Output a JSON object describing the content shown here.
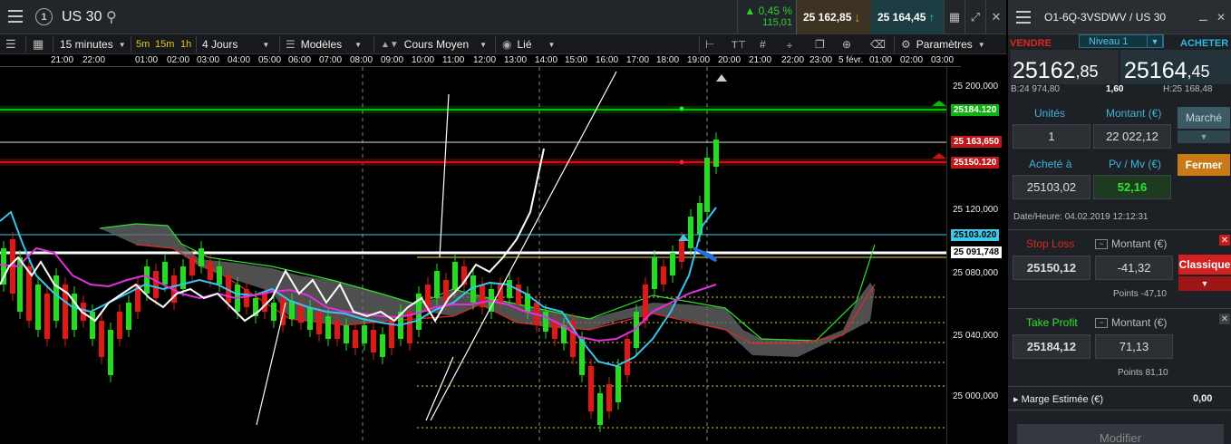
{
  "header": {
    "symbol": "US 30",
    "change_pct": "▲ 0,45 %",
    "change_abs": "115,01",
    "sell_price": "25 162,85",
    "buy_price": "25 164,45"
  },
  "toolbar": {
    "timeframe": "15 minutes",
    "quick_frames": [
      "5m",
      "15m",
      "1h"
    ],
    "period": "4 Jours",
    "models": "Modèles",
    "indicator": "Cours Moyen",
    "link": "Lié",
    "settings": "Paramètres"
  },
  "time_axis": [
    "21:00",
    "22:00",
    "01:00",
    "02:00",
    "03:00",
    "04:00",
    "05:00",
    "06:00",
    "07:00",
    "08:00",
    "09:00",
    "10:00",
    "11:00",
    "12:00",
    "13:00",
    "14:00",
    "15:00",
    "16:00",
    "17:00",
    "18:00",
    "19:00",
    "20:00",
    "21:00",
    "22:00",
    "23:00",
    "5 févr.",
    "01:00",
    "02:00",
    "03:00"
  ],
  "price_axis": {
    "labels": [
      "25 200,000",
      "25 160,000",
      "25 120,000",
      "25 080,000",
      "25 040,000",
      "25 000,000"
    ],
    "take_profit_tag": "25184.120",
    "current_tag": "25 163,650",
    "stop_loss_tag": "25150.120",
    "entry_tag": "25103.020",
    "line_tag": "25 091,748"
  },
  "order_panel": {
    "title": "O1-6Q-3VSDWV / US 30",
    "sell_label": "VENDRE",
    "buy_label": "ACHETER",
    "level": "Niveau 1",
    "sell_main": "25162",
    "sell_dec": ",85",
    "buy_main": "25164",
    "buy_dec": ",45",
    "bid": "B:24 974,80",
    "spread": "1,60",
    "high": "H:25 168,48",
    "units_label": "Unités",
    "units_value": "1",
    "amount_label": "Montant (€)",
    "amount_value": "22 022,12",
    "market_btn": "Marché",
    "bought_at_label": "Acheté à",
    "bought_at_value": "25103,02",
    "pnl_label": "Pv / Mv (€)",
    "pnl_value": "52,16",
    "close_btn": "Fermer",
    "datetime": "Date/Heure: 04.02.2019 12:12:31",
    "stop_loss": {
      "label": "Stop Loss",
      "amount_label": "Montant (€)",
      "price": "25150,12",
      "amount": "-41,32",
      "points": "Points -47,10",
      "type_btn": "Classique"
    },
    "take_profit": {
      "label": "Take Profit",
      "amount_label": "Montant (€)",
      "price": "25184,12",
      "amount": "71,13",
      "points": "Points 81,10"
    },
    "margin_label": "Marge Estimée (€)",
    "margin_value": "0,00",
    "modify_btn": "Modifier"
  },
  "colors": {
    "take_profit": "#00c000",
    "stop_loss": "#d01010",
    "entry": "#3fc8e8",
    "bullish_candle": "#22dd22",
    "bearish_candle": "#e01818",
    "ma_blue": "#38c4ee",
    "ma_magenta": "#e030e0",
    "ma_white": "#ffffff"
  }
}
